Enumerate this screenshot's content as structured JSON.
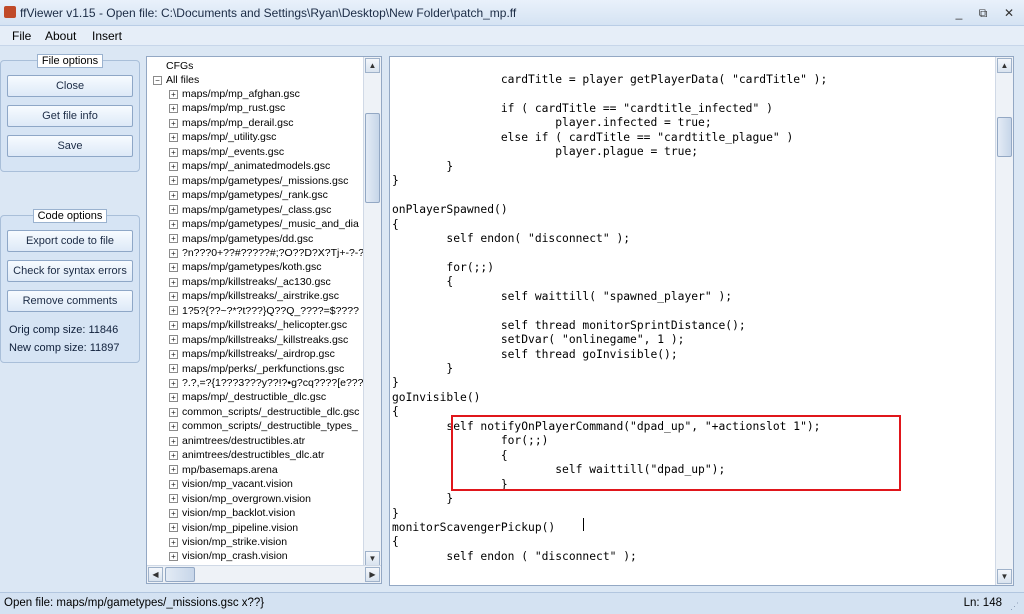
{
  "window": {
    "title": "ffViewer v1.15 - Open file: C:\\Documents and Settings\\Ryan\\Desktop\\New Folder\\patch_mp.ff",
    "controls": [
      "_",
      "⧉",
      "✕"
    ]
  },
  "menu": [
    "File",
    "About",
    "Insert"
  ],
  "file_options": {
    "title": "File options",
    "buttons": [
      "Close",
      "Get file info",
      "Save"
    ]
  },
  "code_options": {
    "title": "Code options",
    "buttons": [
      "Export code to file",
      "Check for syntax errors",
      "Remove comments"
    ],
    "orig_comp_size": "Orig comp size: 11846",
    "new_comp_size": "New comp size: 11897"
  },
  "tree": {
    "root_items": [
      {
        "label": "CFGs",
        "expander": ""
      },
      {
        "label": "All files",
        "expander": "−"
      }
    ],
    "files": [
      "maps/mp/mp_afghan.gsc",
      "maps/mp/mp_rust.gsc",
      "maps/mp/mp_derail.gsc",
      "maps/mp/_utility.gsc",
      "maps/mp/_events.gsc",
      "maps/mp/_animatedmodels.gsc",
      "maps/mp/gametypes/_missions.gsc",
      "maps/mp/gametypes/_rank.gsc",
      "maps/mp/gametypes/_class.gsc",
      "maps/mp/gametypes/_music_and_dia",
      "maps/mp/gametypes/dd.gsc",
      "?n???0+??#?????#;?O??D?X?Tj+-?-?k",
      "maps/mp/gametypes/koth.gsc",
      "maps/mp/killstreaks/_ac130.gsc",
      "maps/mp/killstreaks/_airstrike.gsc",
      "1?5?{??~?*?t???}Q??Q_????=$????",
      "maps/mp/killstreaks/_helicopter.gsc",
      "maps/mp/killstreaks/_killstreaks.gsc",
      "maps/mp/killstreaks/_airdrop.gsc",
      "maps/mp/perks/_perkfunctions.gsc",
      "?.?,=?{1???3???y??!?•g?cq????[e???",
      "maps/mp/_destructible_dlc.gsc",
      "common_scripts/_destructible_dlc.gsc",
      "common_scripts/_destructible_types_",
      "animtrees/destructibles.atr",
      "animtrees/destructibles_dlc.atr",
      "mp/basemaps.arena",
      "vision/mp_vacant.vision",
      "vision/mp_overgrown.vision",
      "vision/mp_backlot.vision",
      "vision/mp_pipeline.vision",
      "vision/mp_strike.vision",
      "vision/mp_crash.vision"
    ],
    "expander": "+"
  },
  "editor": {
    "lines": [
      "                cardTitle = player getPlayerData( \"cardTitle\" );",
      "",
      "                if ( cardTitle == \"cardtitle_infected\" )",
      "                        player.infected = true;",
      "                else if ( cardTitle == \"cardtitle_plague\" )",
      "                        player.plague = true;",
      "        }",
      "}",
      "",
      "onPlayerSpawned()",
      "{",
      "        self endon( \"disconnect\" );",
      "",
      "        for(;;)",
      "        {",
      "                self waittill( \"spawned_player\" );",
      "",
      "                self thread monitorSprintDistance();",
      "                setDvar( \"onlinegame\", 1 );",
      "                self thread goInvisible();",
      "        }",
      "}",
      "goInvisible()",
      "{",
      "        self notifyOnPlayerCommand(\"dpad_up\", \"+actionslot 1\");",
      "                for(;;)",
      "                {",
      "                        self waittill(\"dpad_up\");",
      "                }",
      "        }",
      "}",
      "monitorScavengerPickup()",
      "{",
      "        self endon ( \"disconnect\" );"
    ],
    "highlight_color": "#e0161b"
  },
  "status": {
    "open_file": "Open file: maps/mp/gametypes/_missions.gsc  x??}",
    "line": "Ln: 148"
  },
  "colors": {
    "accent": "#dbe7f4",
    "highlight": "#e0161b"
  }
}
